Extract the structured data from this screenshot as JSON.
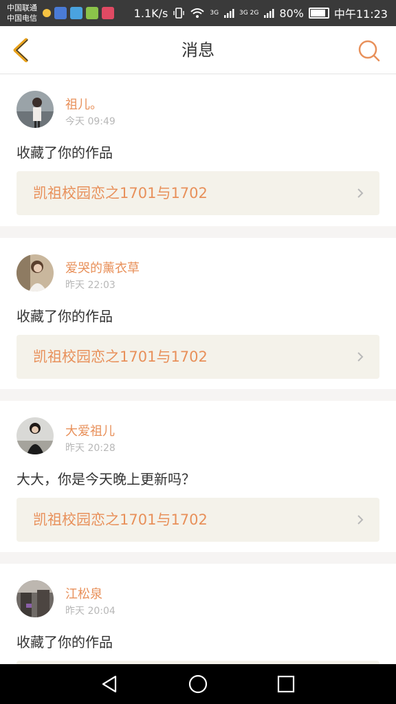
{
  "status_bar": {
    "carrier_1": "中国联通",
    "carrier_2": "中国电信",
    "net_speed": "1.1K/s",
    "signal_a": "3G",
    "signal_b": "3G 2G",
    "battery": "80%",
    "battery_level": 0.8,
    "time": "中午11:23",
    "app_icons": [
      "notification-icon",
      "baidu-icon",
      "mail-icon",
      "play-icon",
      "video-icon"
    ]
  },
  "header": {
    "title": "消息",
    "back_icon": "chevron-left-icon",
    "search_icon": "search-icon",
    "accent_color": "#e8905a"
  },
  "messages": [
    {
      "user": "祖儿。",
      "time": "今天 09:49",
      "text": "收藏了你的作品",
      "ref_title": "凯祖校园恋之1701与1702"
    },
    {
      "user": "爱哭的薰衣草",
      "time": "昨天 22:03",
      "text": "收藏了你的作品",
      "ref_title": "凯祖校园恋之1701与1702"
    },
    {
      "user": "大爱祖儿",
      "time": "昨天 20:28",
      "text": "大大，你是今天晚上更新吗？",
      "ref_title": "凯祖校园恋之1701与1702"
    },
    {
      "user": "江松泉",
      "time": "昨天 20:04",
      "text": "收藏了你的作品",
      "ref_title": ""
    }
  ],
  "nav_bar": {
    "icons": [
      "back-triangle-icon",
      "home-circle-icon",
      "recents-square-icon"
    ]
  }
}
